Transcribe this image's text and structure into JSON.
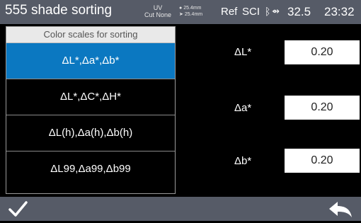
{
  "status": {
    "title": "555 shade sorting",
    "uv_line1": "UV",
    "uv_line2": "Cut None",
    "aperture_line1": "25.4mm",
    "aperture_line2": "25.4mm",
    "ref": "Ref",
    "sci": "SCI",
    "temperature": "32.5",
    "time": "23:32"
  },
  "scales": {
    "header": "Color scales for sorting",
    "items": [
      {
        "label": "ΔL*,Δa*,Δb*",
        "selected": true
      },
      {
        "label": "ΔL*,ΔC*,ΔH*",
        "selected": false
      },
      {
        "label": "ΔL(h),Δa(h),Δb(h)",
        "selected": false
      },
      {
        "label": "ΔL99,Δa99,Δb99",
        "selected": false
      }
    ]
  },
  "tolerances": {
    "dl_label": "ΔL*",
    "dl_value": "0.20",
    "da_label": "Δa*",
    "da_value": "0.20",
    "db_label": "Δb*",
    "db_value": "0.20"
  },
  "colors": {
    "bar": "#565b67",
    "selected": "#0b78c1",
    "background": "#000000"
  },
  "icons": {
    "confirm": "checkmark-icon",
    "back": "back-arrow-icon"
  }
}
